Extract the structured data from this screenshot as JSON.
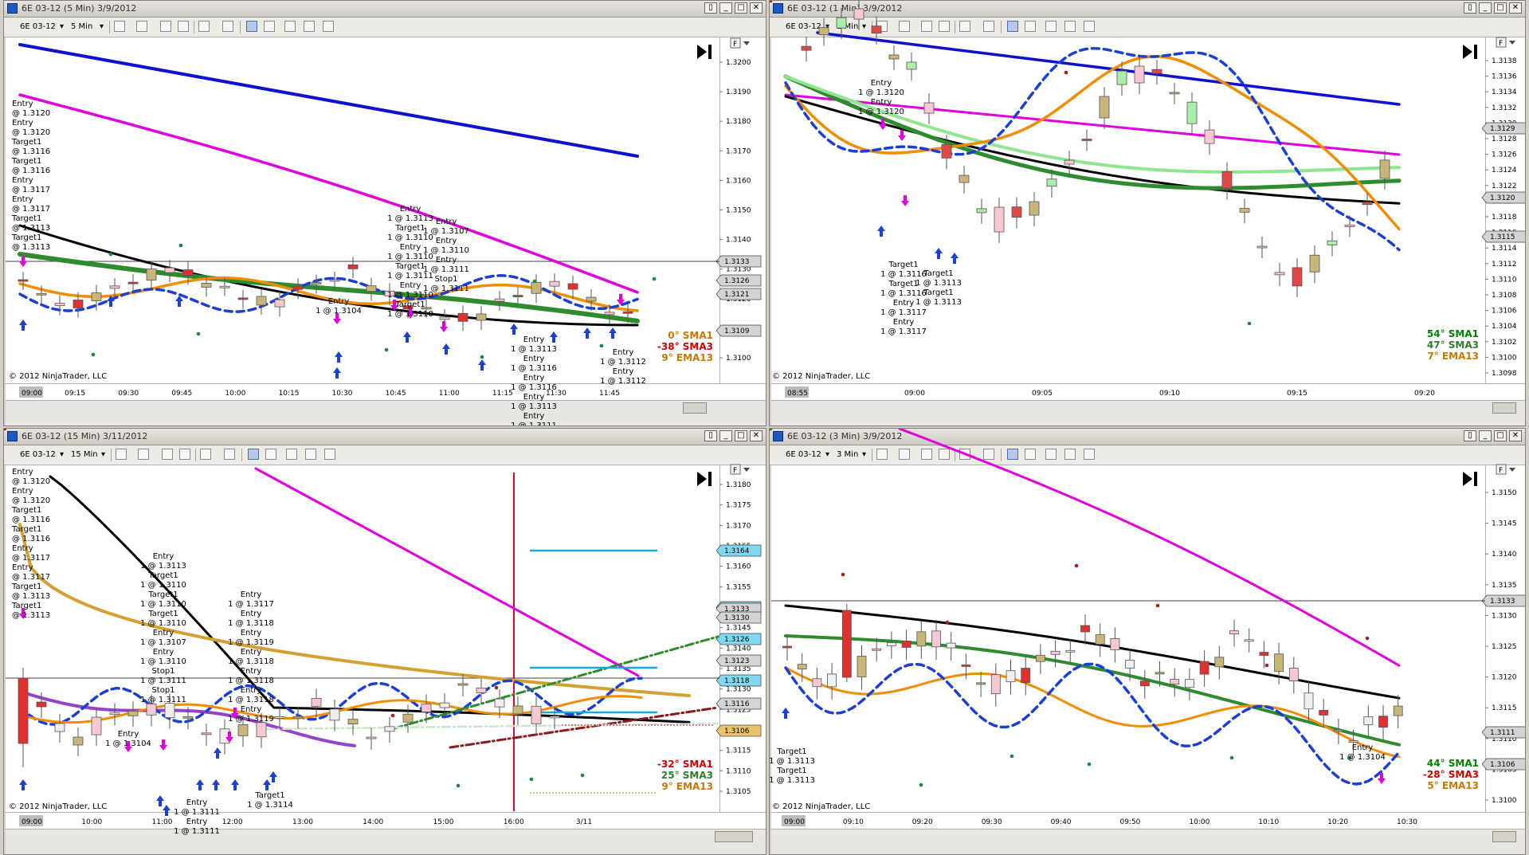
{
  "toolbar_common": {
    "interval_caret": "▾",
    "f_label": "F",
    "play_icon": "play-end-icon"
  },
  "window_buttons": [
    "▯",
    "_",
    "□",
    "✕"
  ],
  "colors": {
    "sma_slow_blue": "#1010d0",
    "sma_magenta": "#e000e0",
    "sma_black": "#000000",
    "sma_green": "#2e8b2e",
    "sma_lightgreen": "#8ee68e",
    "ema_orange": "#f28c00",
    "dashed_blue": "#1b3fd6"
  },
  "panels": [
    {
      "id": "p1",
      "title": "6E 03-12 (5 Min)  3/9/2012",
      "instrument": "6E 03-12",
      "interval": "5 Min",
      "copyright": "© 2012 NinjaTrader, LLC",
      "time_ticks": [
        "09:00",
        "09:15",
        "09:30",
        "09:45",
        "10:00",
        "10:15",
        "10:30",
        "10:45",
        "11:00",
        "11:15",
        "11:30",
        "11:45"
      ],
      "price_ticks": [
        "1.3200",
        "1.3190",
        "1.3180",
        "1.3170",
        "1.3160",
        "1.3150",
        "1.3140",
        "1.3130",
        "1.3120",
        "1.3110",
        "1.3100"
      ],
      "price_tags": [
        "1.3133",
        "1.3126",
        "1.3121",
        "1.3109"
      ],
      "legend": [
        {
          "text": "0° SMA1",
          "color": "#c87800"
        },
        {
          "text": "-38° SMA3",
          "color": "#d00000"
        },
        {
          "text": "9° EMA13",
          "color": "#c87800"
        }
      ],
      "order_text": [
        "Entry",
        "@ 1.3120",
        "Entry",
        "@ 1.3120",
        "Target1",
        "@ 1.3116",
        "Target1",
        "@ 1.3116",
        "Entry",
        "@ 1.3117",
        "Entry",
        "@ 1.3117",
        "Target1",
        "@ 1.3113",
        "Target1",
        "@ 1.3113"
      ],
      "mid_text": [
        "Entry",
        "1 @ 1.3113",
        "Target1",
        "1 @ 1.3110",
        "Entry",
        "1 @ 1.3110",
        "Target1",
        "1 @ 1.3111",
        "Entry",
        "1 @ 1.3110",
        "Target1",
        "1 @ 1.3110"
      ],
      "mid_text2": [
        "Entry",
        "1 @ 1.3107",
        "Entry",
        "1 @ 1.3110",
        "Entry",
        "1 @ 1.3111",
        "Stop1",
        "1 @ 1.3111"
      ],
      "entry_text": [
        "Entry",
        "1 @ 1.3104"
      ],
      "right_text": [
        "Entry",
        "1 @ 1.3113",
        "Entry",
        "1 @ 1.3116",
        "Entry",
        "1 @ 1.3116",
        "Entry",
        "1 @ 1.3113",
        "Entry",
        "1 @ 1.3111"
      ],
      "right_text2": [
        "Entry",
        "1 @ 1.3112",
        "Entry",
        "1 @ 1.3112"
      ]
    },
    {
      "id": "p2",
      "title": "6E 03-12 (1 Min)  3/9/2012",
      "instrument": "6E 03-12",
      "interval": "1 Min",
      "copyright": "© 2012 NinjaTrader, LLC",
      "time_ticks": [
        "08:55",
        "09:00",
        "09:05",
        "09:10",
        "09:15",
        "09:20"
      ],
      "price_ticks": [
        "1.3138",
        "1.3136",
        "1.3134",
        "1.3132",
        "1.3130",
        "1.3128",
        "1.3126",
        "1.3124",
        "1.3122",
        "1.3120",
        "1.3118",
        "1.3116",
        "1.3114",
        "1.3112",
        "1.3110",
        "1.3108",
        "1.3106",
        "1.3104",
        "1.3102",
        "1.3100",
        "1.3098"
      ],
      "price_tags": [
        "1.3129",
        "1.3120",
        "1.3115"
      ],
      "legend": [
        {
          "text": "54° SMA1",
          "color": "#008000"
        },
        {
          "text": "47° SMA3",
          "color": "#2e7d2e"
        },
        {
          "text": "7° EMA13",
          "color": "#c87800"
        }
      ],
      "order_text": [
        "Entry",
        "1 @ 1.3120",
        "Entry",
        "1 @ 1.3120"
      ],
      "lower_text": [
        "Target1",
        "1 @ 1.3116",
        "Target1",
        "1 @ 1.3116",
        "Entry",
        "1 @ 1.3117",
        "Entry",
        "1 @ 1.3117"
      ],
      "lower_text2": [
        "Target1",
        "1 @ 1.3113",
        "Target1",
        "1 @ 1.3113"
      ]
    },
    {
      "id": "p3",
      "title": "6E 03-12 (15 Min)  3/11/2012",
      "instrument": "6E 03-12",
      "interval": "15 Min",
      "copyright": "© 2012 NinjaTrader, LLC",
      "time_ticks": [
        "09:00",
        "10:00",
        "11:00",
        "12:00",
        "13:00",
        "14:00",
        "15:00",
        "16:00",
        "3/11"
      ],
      "price_ticks": [
        "1.3180",
        "1.3175",
        "1.3170",
        "1.3165",
        "1.3160",
        "1.3155",
        "1.3150",
        "1.3145",
        "1.3140",
        "1.3135",
        "1.3130",
        "1.3125",
        "1.3120",
        "1.3115",
        "1.3110",
        "1.3105"
      ],
      "price_tags": [
        "1.3164",
        "1.3135",
        "1.3133",
        "1.3130",
        "1.3126",
        "1.3123",
        "1.3118",
        "1.3116",
        "1.3106"
      ],
      "legend": [
        {
          "text": "-32° SMA1",
          "color": "#d00000"
        },
        {
          "text": "25° SMA3",
          "color": "#2e7d2e"
        },
        {
          "text": "9° EMA13",
          "color": "#c87800"
        }
      ],
      "order_text": [
        "Entry",
        "@ 1.3120",
        "Entry",
        "@ 1.3120",
        "Target1",
        "@ 1.3116",
        "Target1",
        "@ 1.3116",
        "Entry",
        "@ 1.3117",
        "Entry",
        "@ 1.3117",
        "Target1",
        "@ 1.3113",
        "Target1",
        "@ 1.3113"
      ],
      "mid_text": [
        "Entry",
        "1 @ 1.3113",
        "Target1",
        "1 @ 1.3110",
        "Target1",
        "1 @ 1.3110",
        "Target1",
        "1 @ 1.3110",
        "Entry",
        "1 @ 1.3107",
        "Entry",
        "1 @ 1.3110",
        "Stop1",
        "1 @ 1.3111",
        "Stop1",
        "1 @ 1.3111"
      ],
      "mid_text2": [
        "Entry",
        "1 @ 1.3117",
        "Entry",
        "1 @ 1.3118",
        "Entry",
        "1 @ 1.3119",
        "Entry",
        "1 @ 1.3118",
        "Entry",
        "1 @ 1.3118",
        "Entry",
        "1 @ 1.3118",
        "Entry",
        "1 @ 1.3119"
      ],
      "entry_text": [
        "Entry",
        "1 @ 1.3104"
      ],
      "bottom_text": [
        "Entry",
        "1 @ 1.3111",
        "Entry",
        "1 @ 1.3111"
      ],
      "bottom_text2": [
        "Target1",
        "1 @ 1.3114"
      ]
    },
    {
      "id": "p4",
      "title": "6E 03-12 (3 Min)  3/9/2012",
      "instrument": "6E 03-12",
      "interval": "3 Min",
      "copyright": "© 2012 NinjaTrader, LLC",
      "time_ticks": [
        "09:00",
        "09:10",
        "09:20",
        "09:30",
        "09:40",
        "09:50",
        "10:00",
        "10:10",
        "10:20",
        "10:30"
      ],
      "price_ticks": [
        "1.3150",
        "1.3145",
        "1.3140",
        "1.3135",
        "1.3130",
        "1.3125",
        "1.3120",
        "1.3115",
        "1.3110",
        "1.3105",
        "1.3100"
      ],
      "price_tags": [
        "1.3133",
        "1.3111",
        "1.3106"
      ],
      "legend": [
        {
          "text": "44° SMA1",
          "color": "#008000"
        },
        {
          "text": "-28° SMA3",
          "color": "#d00000"
        },
        {
          "text": "5° EMA13",
          "color": "#c87800"
        }
      ],
      "order_text": [
        "Target1",
        "1 @ 1.3113",
        "Target1",
        "1 @ 1.3113"
      ],
      "entry_text": [
        "Entry",
        "1 @ 1.3104"
      ]
    }
  ]
}
